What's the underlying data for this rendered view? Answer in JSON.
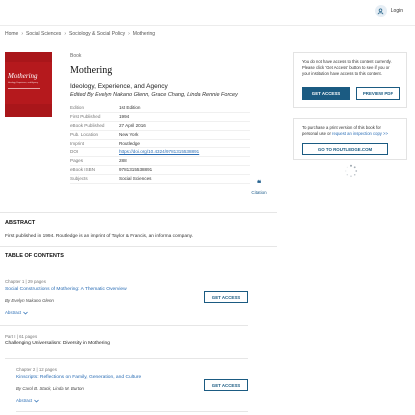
{
  "header": {
    "login_label": "Login"
  },
  "breadcrumb": [
    "Home",
    "Social Sciences",
    "Sociology & Social Policy",
    "Mothering"
  ],
  "cover": {
    "title": "Mothering",
    "subtitle": "Ideology, Experience, and Agency",
    "color": "#a9161a"
  },
  "book": {
    "type_label": "Book",
    "title": "Mothering",
    "subtitle": "Ideology, Experience, and Agency",
    "edited_by_prefix": "Edited By",
    "editors": "Evelyn Nakano Glenn, Grace Chang, Linda Rennie Forcey"
  },
  "meta": [
    {
      "key": "Edition",
      "value": "1st Edition"
    },
    {
      "key": "First Published",
      "value": "1994"
    },
    {
      "key": "eBook Published",
      "value": "27 April 2016"
    },
    {
      "key": "Pub. Location",
      "value": "New York"
    },
    {
      "key": "Imprint",
      "value": "Routledge"
    },
    {
      "key": "DOI",
      "value": "https://doi.org/10.4324/9781315538891",
      "link": true
    },
    {
      "key": "Pages",
      "value": "288"
    },
    {
      "key": "eBook ISBN",
      "value": "9781315538891"
    },
    {
      "key": "Subjects",
      "value": "Social Sciences"
    }
  ],
  "citation": {
    "label": "Citation"
  },
  "access": {
    "message": "You do not have access to this content currently. Please click 'Get Access' button to see if you or your institution have access to this content.",
    "get_access": "GET ACCESS",
    "preview": "PREVIEW PDF"
  },
  "print": {
    "message": "To purchase a print version of this book for personal use or",
    "link": "request an inspection copy",
    "arrow": ">>",
    "button": "GO TO ROUTLEDGE.COM"
  },
  "abstract": {
    "heading": "ABSTRACT",
    "text": "First published in 1994. Routledge is an imprint of Taylor & Francis, an informa company."
  },
  "toc": {
    "heading": "TABLE OF CONTENTS",
    "chapter1": {
      "meta": "Chapter 1  |  29 pages",
      "title": "Social Constructions of Mothering: A Thematic Overview",
      "by": "By",
      "authors": "Evelyn Nakano Glenn",
      "abstract": "Abstract",
      "button": "GET ACCESS"
    },
    "part1": {
      "meta": "Part I  |  61 pages",
      "title": "Challenging Universalism: Diversity in Mothering"
    },
    "chapter2": {
      "meta": "Chapter 2  |  12 pages",
      "title": "Kinscripts: Reflections on Family, Generation, and Culture",
      "by": "By",
      "authors": "Carol B. Stack, Linda M. Burton",
      "abstract": "Abstract",
      "button": "GET ACCESS"
    }
  },
  "colors": {
    "accent": "#1b5b82",
    "link": "#2a6db5",
    "cover": "#a9161a"
  },
  "icons": {
    "login": "user-icon",
    "citation": "quote-icon",
    "loading": "spinner-icon",
    "expand": "chevron-down-icon"
  }
}
